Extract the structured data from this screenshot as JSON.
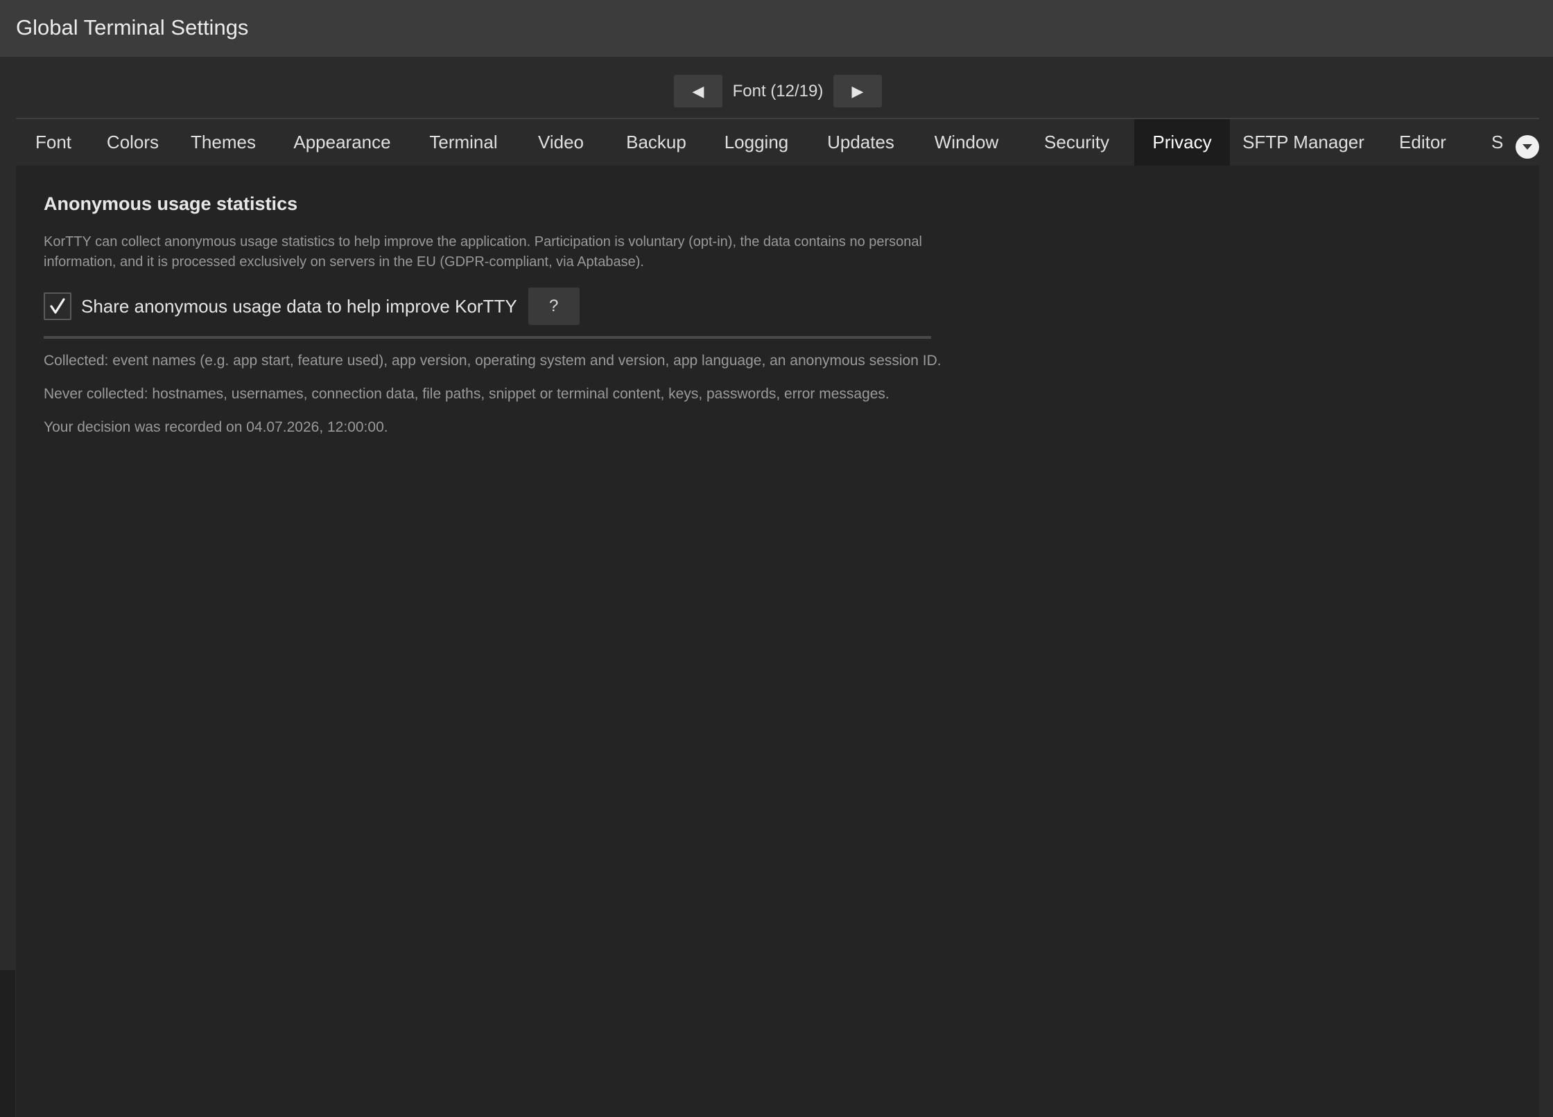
{
  "window": {
    "title": "Global Terminal Settings"
  },
  "pager": {
    "prev_icon": "◀",
    "next_icon": "▶",
    "label": "Font  (12/19)"
  },
  "tabs": [
    {
      "label": "Font"
    },
    {
      "label": "Colors"
    },
    {
      "label": "Themes"
    },
    {
      "label": "Appearance"
    },
    {
      "label": "Terminal"
    },
    {
      "label": "Video"
    },
    {
      "label": "Backup"
    },
    {
      "label": "Logging"
    },
    {
      "label": "Updates"
    },
    {
      "label": "Window"
    },
    {
      "label": "Security"
    },
    {
      "label": "Privacy",
      "active": true
    },
    {
      "label": "SFTP Manager"
    },
    {
      "label": "Editor"
    },
    {
      "label": "S"
    }
  ],
  "privacy": {
    "section_title": "Anonymous usage statistics",
    "description": "KorTTY can collect anonymous usage statistics to help improve the application. Participation is voluntary (opt-in), the data contains no personal information, and it is processed exclusively on servers in the EU (GDPR-compliant, via Aptabase).",
    "consent_label": "Share anonymous usage data to help improve KorTTY",
    "consent_checked": true,
    "help_label": "?",
    "collected": "Collected: event names (e.g. app start, feature used), app version, operating system and version, app language, an anonymous session ID.",
    "never_collected": "Never collected: hostnames, usernames, connection data, file paths, snippet or terminal content, keys, passwords, error messages.",
    "decision": "Your decision was recorded on 04.07.2026, 12:00:00."
  },
  "colors": {
    "titlebar": "#3c3c3c",
    "background": "#2b2b2b",
    "content": "#242424",
    "active_tab": "#1c1c1c"
  }
}
